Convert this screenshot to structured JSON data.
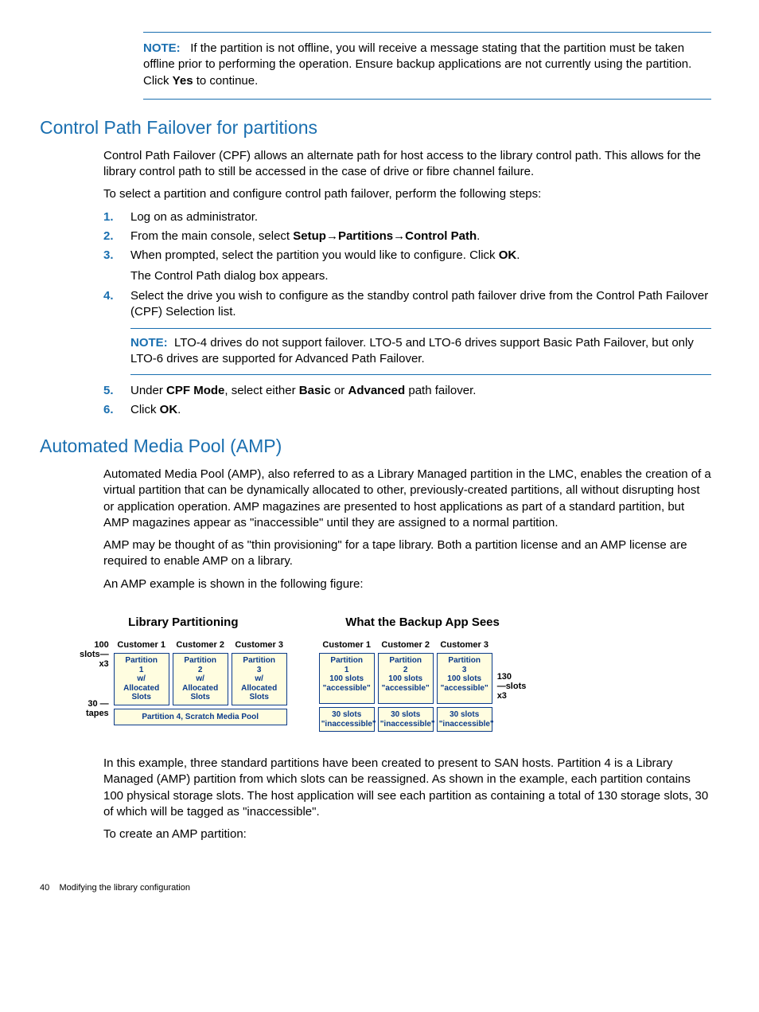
{
  "note1": {
    "label": "NOTE:",
    "text_a": "If the partition is not offline, you will receive a message stating that the partition must be taken offline prior to performing the operation. Ensure backup applications are not currently using the partition. Click ",
    "yes": "Yes",
    "text_b": " to continue."
  },
  "section1": {
    "heading": "Control Path Failover for partitions",
    "p1": "Control Path Failover (CPF) allows an alternate path for host access to the library control path. This allows for the library control path to still be accessed in the case of drive or fibre channel failure.",
    "p2": "To select a partition and configure control path failover, perform the following steps:",
    "steps": {
      "s1": "Log on as administrator.",
      "s2a": "From the main console, select ",
      "s2b": "Setup",
      "s2c": "→",
      "s2d": "Partitions",
      "s2e": "→",
      "s2f": "Control Path",
      "s2g": ".",
      "s3a": "When prompted, select the partition you would like to configure. Click ",
      "s3b": "OK",
      "s3c": ".",
      "s3sub": "The Control Path dialog box appears.",
      "s4": "Select the drive you wish to configure as the standby control path failover drive from the Control Path Failover (CPF) Selection list.",
      "note2_label": "NOTE:",
      "note2_text": "LTO-4 drives do not support failover. LTO-5 and LTO-6 drives support Basic Path Failover, but only LTO-6 drives are supported for Advanced Path Failover.",
      "s5a": "Under ",
      "s5b": "CPF Mode",
      "s5c": ", select either ",
      "s5d": "Basic",
      "s5e": " or ",
      "s5f": "Advanced",
      "s5g": " path failover.",
      "s6a": "Click ",
      "s6b": "OK",
      "s6c": "."
    }
  },
  "section2": {
    "heading": "Automated Media Pool (AMP)",
    "p1": "Automated Media Pool (AMP), also referred to as a Library Managed partition in the LMC, enables the creation of a virtual partition that can be dynamically allocated to other, previously-created partitions, all without disrupting host or application operation. AMP magazines are presented to host applications as part of a standard partition, but AMP magazines appear as \"inaccessible\" until they are assigned to a normal partition.",
    "p2": "AMP may be thought of as \"thin provisioning\" for a tape library. Both a partition license and an AMP license are required to enable AMP on a library.",
    "p3": "An AMP example is shown in the following figure:",
    "p4": "In this example, three standard partitions have been created to present to SAN hosts. Partition 4 is a Library Managed (AMP) partition from which slots can be reassigned. As shown in the example, each partition contains 100 physical storage slots. The host application will see each partition as containing a total of 130 storage slots, 30 of which will be tagged as \"inaccessible\".",
    "p5": "To create an AMP partition:"
  },
  "figure": {
    "left_title": "Library Partitioning",
    "right_title": "What the Backup App Sees",
    "customers": [
      "Customer 1",
      "Customer 2",
      "Customer 3"
    ],
    "left_label1a": "100",
    "left_label1b": "slots",
    "left_label1c": "x3",
    "left_label2a": "30",
    "left_label2b": "tapes",
    "left_cells": [
      "Partition 1 w/ Allocated Slots",
      "Partition 2 w/ Allocated Slots",
      "Partition 3 w/ Allocated Slots"
    ],
    "left_wide": "Partition 4, Scratch Media Pool",
    "right_top": [
      "Partition 1 100 slots \"accessible\"",
      "Partition 2 100 slots \"accessible\"",
      "Partition 3 100 slots \"accessible\""
    ],
    "right_bottom": [
      "30 slots \"inaccessible\"",
      "30 slots \"inaccessible\"",
      "30 slots \"inaccessible\""
    ],
    "right_label_a": "130",
    "right_label_b": "slots",
    "right_label_c": "x3"
  },
  "footer": {
    "page": "40",
    "title": "Modifying the library configuration"
  }
}
